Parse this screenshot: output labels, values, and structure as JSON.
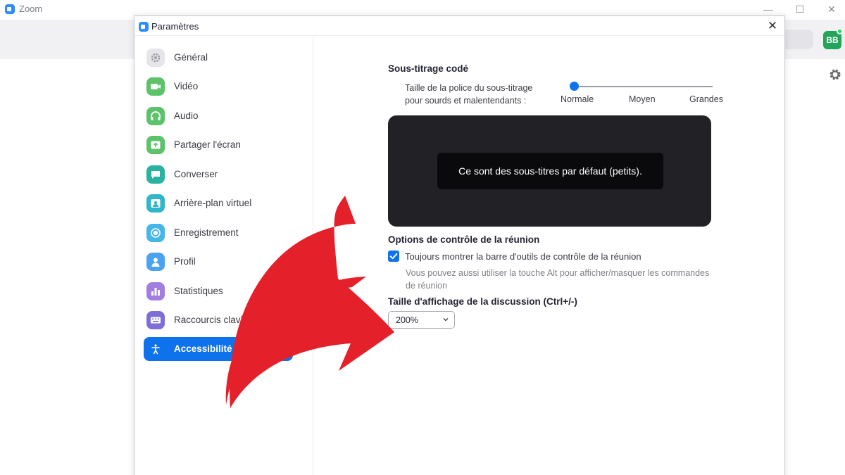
{
  "app": {
    "title": "Zoom",
    "avatar_initials": "BB"
  },
  "dialog": {
    "title": "Paramètres"
  },
  "sidebar": {
    "items": [
      {
        "label": "Général",
        "icon": "gear-icon",
        "color": "#d9d9de"
      },
      {
        "label": "Vidéo",
        "icon": "camera-icon",
        "color": "#5cc36a"
      },
      {
        "label": "Audio",
        "icon": "headphones-icon",
        "color": "#5cc36a"
      },
      {
        "label": "Partager l'écran",
        "icon": "share-screen-icon",
        "color": "#5cc36a"
      },
      {
        "label": "Converser",
        "icon": "chat-icon",
        "color": "#2ab3a0"
      },
      {
        "label": "Arrière-plan virtuel",
        "icon": "person-background-icon",
        "color": "#31b6c9"
      },
      {
        "label": "Enregistrement",
        "icon": "record-icon",
        "color": "#44b6e8"
      },
      {
        "label": "Profil",
        "icon": "person-icon",
        "color": "#4ba3f0"
      },
      {
        "label": "Statistiques",
        "icon": "bar-chart-icon",
        "color": "#a27ee0"
      },
      {
        "label": "Raccourcis clavier",
        "icon": "keyboard-icon",
        "color": "#7d6fd6"
      },
      {
        "label": "Accessibilité",
        "icon": "accessibility-icon",
        "color": "#0e72ed",
        "active": true
      }
    ]
  },
  "captions": {
    "title": "Sous-titrage codé",
    "font_size_label_line1": "Taille de la police du sous-titrage",
    "font_size_label_line2": "pour sourds et malentendants :",
    "slider_options": [
      "Normale",
      "Moyen",
      "Grandes"
    ],
    "selected_option": "Normale",
    "preview_text": "Ce sont des sous-titres par défaut (petits)."
  },
  "meeting_controls": {
    "title": "Options de contrôle de la réunion",
    "checkbox_label": "Toujours montrer la barre d'outils de contrôle de la réunion",
    "checkbox_checked": true,
    "hint_line1": "Vous pouvez aussi utiliser la touche Alt pour afficher/masquer les commandes",
    "hint_line2": "de réunion"
  },
  "chat_display": {
    "title": "Taille d'affichage de la discussion (Ctrl+/-)",
    "selected_value": "200%"
  },
  "colors": {
    "accent": "#0e72ed",
    "arrow": "#e8232a"
  }
}
